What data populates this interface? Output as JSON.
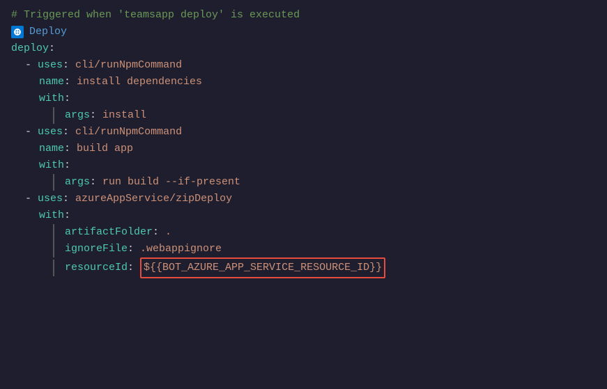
{
  "colors": {
    "bg": "#1e1e2e",
    "comment": "#6a9955",
    "keyword": "#569cd6",
    "key": "#4ec9b0",
    "value": "#ce9178",
    "plain": "#d4d4d4",
    "variable": "#dcdcaa",
    "highlight_border": "#e74c3c",
    "deploy_icon": "#0078d4"
  },
  "lines": [
    {
      "id": "comment",
      "text": "# Triggered when 'teamsapp deploy' is executed",
      "type": "comment"
    },
    {
      "id": "deploy-badge",
      "text": "Deploy",
      "type": "badge"
    },
    {
      "id": "deploy-key",
      "text": "deploy:",
      "type": "plain-key"
    },
    {
      "id": "uses1",
      "type": "uses-line",
      "dash": "-",
      "key": "uses",
      "value": "cli/runNpmCommand"
    },
    {
      "id": "name1",
      "type": "key-value",
      "indent": 2,
      "key": "name",
      "value": "install dependencies"
    },
    {
      "id": "with1",
      "type": "key-only",
      "indent": 2,
      "key": "with"
    },
    {
      "id": "args1",
      "type": "pipe-key-value",
      "key": "args",
      "value": "install"
    },
    {
      "id": "uses2",
      "type": "uses-line",
      "dash": "-",
      "key": "uses",
      "value": "cli/runNpmCommand"
    },
    {
      "id": "name2",
      "type": "key-value",
      "indent": 2,
      "key": "name",
      "value": "build app"
    },
    {
      "id": "with2",
      "type": "key-only",
      "indent": 2,
      "key": "with"
    },
    {
      "id": "args2",
      "type": "pipe-key-value",
      "key": "args",
      "value": "run build --if-present"
    },
    {
      "id": "uses3",
      "type": "uses-line",
      "dash": "-",
      "key": "uses",
      "value": "azureAppService/zipDeploy"
    },
    {
      "id": "with3",
      "type": "key-only",
      "indent": 2,
      "key": "with"
    },
    {
      "id": "artifact",
      "type": "pipe-key-value",
      "key": "artifactFolder",
      "value": "."
    },
    {
      "id": "ignore",
      "type": "pipe-key-value",
      "key": "ignoreFile",
      "value": ".webappignore"
    },
    {
      "id": "resource",
      "type": "pipe-key-value-highlight",
      "key": "resourceId",
      "value": "${{BOT_AZURE_APP_SERVICE_RESOURCE_ID}}"
    }
  ]
}
